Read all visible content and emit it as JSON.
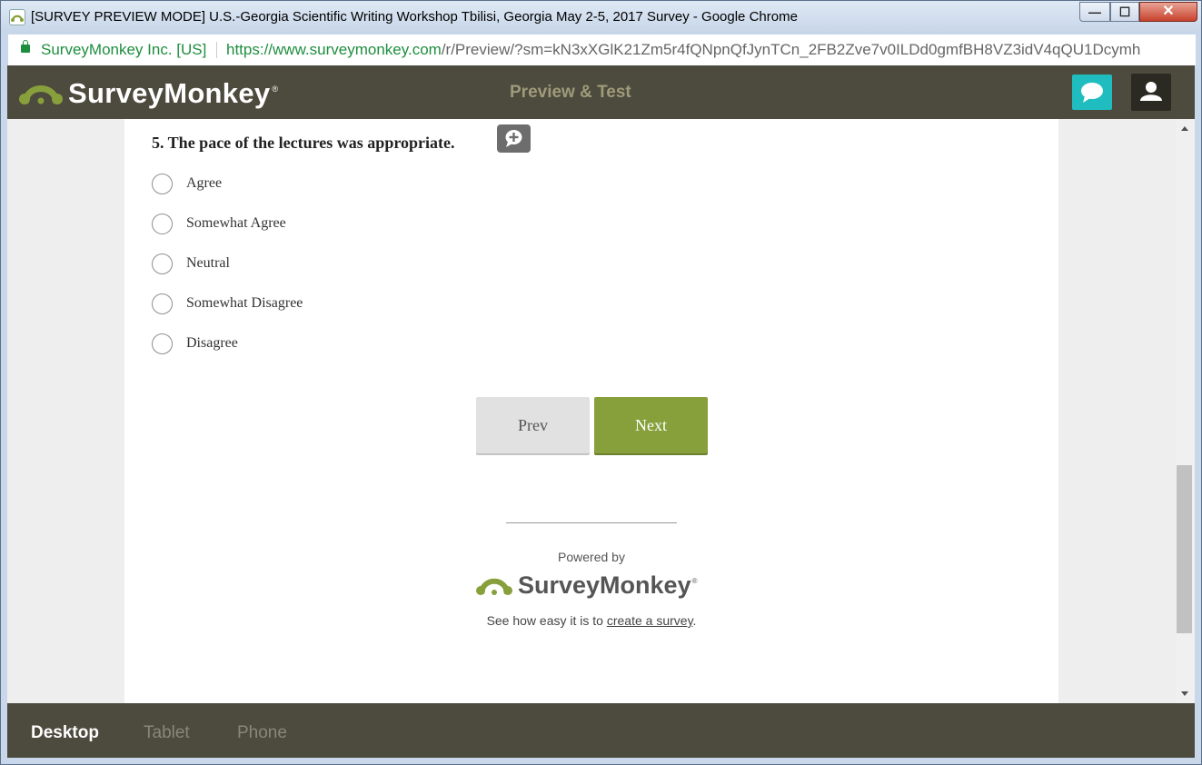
{
  "window": {
    "title": "[SURVEY PREVIEW MODE] U.S.-Georgia Scientific Writing Workshop Tbilisi, Georgia May 2-5, 2017 Survey - Google Chrome",
    "min_symbol": "—",
    "max_symbol": "☐",
    "close_symbol": "✕"
  },
  "address": {
    "site_name": "SurveyMonkey Inc. [US]",
    "url_host": "https://www.surveymonkey.com",
    "url_path": "/r/Preview/?sm=kN3xXGlK21Zm5r4fQNpnQfJynTCn_2FB2Zve7v0ILDd0gmfBH8VZ3idV4qQU1Dcymh"
  },
  "header": {
    "logo_text": "SurveyMonkey",
    "logo_reg": "®",
    "preview_title": "Preview & Test"
  },
  "question": {
    "text": "5. The pace of the lectures was appropriate.",
    "options": [
      "Agree",
      "Somewhat Agree",
      "Neutral",
      "Somewhat Disagree",
      "Disagree"
    ]
  },
  "nav": {
    "prev_label": "Prev",
    "next_label": "Next"
  },
  "footer": {
    "powered_by": "Powered by",
    "logo_text": "SurveyMonkey",
    "logo_reg": "®",
    "tagline_prefix": "See how easy it is to ",
    "tagline_link": "create a survey",
    "tagline_suffix": "."
  },
  "devices": {
    "desktop": "Desktop",
    "tablet": "Tablet",
    "phone": "Phone"
  },
  "colors": {
    "header_bg": "#4d4a3e",
    "brand_green": "#87a03c",
    "chat_teal": "#1fbdbf"
  }
}
